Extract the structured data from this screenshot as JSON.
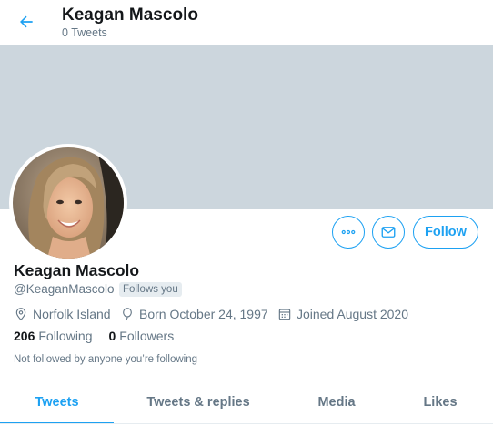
{
  "header": {
    "name": "Keagan Mascolo",
    "tweet_count": "0 Tweets"
  },
  "profile": {
    "name": "Keagan Mascolo",
    "handle": "@KeaganMascolo",
    "follows_you": "Follows you",
    "location": "Norfolk Island",
    "born": "Born October 24, 1997",
    "joined": "Joined August 2020",
    "following_count": "206",
    "following_label": "Following",
    "followers_count": "0",
    "followers_label": "Followers",
    "not_followed": "Not followed by anyone you’re following"
  },
  "actions": {
    "follow_label": "Follow"
  },
  "tabs": [
    {
      "label": "Tweets",
      "active": true
    },
    {
      "label": "Tweets & replies",
      "active": false
    },
    {
      "label": "Media",
      "active": false
    },
    {
      "label": "Likes",
      "active": false
    }
  ],
  "colors": {
    "accent": "#1da1f2",
    "banner": "#ccd6dd",
    "secondary_text": "#657786",
    "primary_text": "#14171a"
  },
  "icons": {
    "back": "arrow-left-icon",
    "more": "more-icon",
    "message": "envelope-icon",
    "location": "location-pin-icon",
    "born": "balloon-icon",
    "joined": "calendar-icon"
  }
}
